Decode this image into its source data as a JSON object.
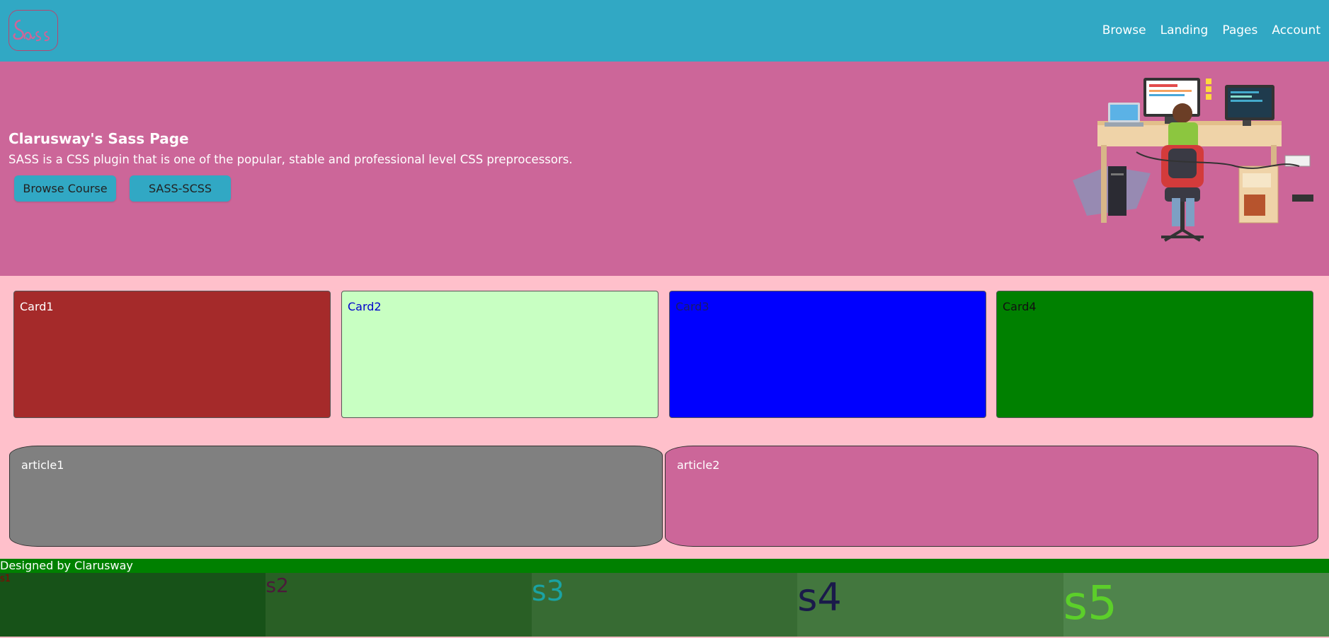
{
  "navbar": {
    "logo_text": "Sass",
    "links": [
      "Browse",
      "Landing",
      "Pages",
      "Account"
    ]
  },
  "hero": {
    "title": "Clarusway's Sass Page",
    "text": "SASS is a CSS plugin that is one of the popular, stable and professional level CSS preprocessors.",
    "buttons": [
      "Browse Course",
      "SASS-SCSS"
    ]
  },
  "cards": [
    "Card1",
    "Card2",
    "Card3",
    "Card4"
  ],
  "articles": [
    "article1",
    "article2"
  ],
  "footer": {
    "text": "Designed by Clarusway"
  },
  "sections": [
    "s1",
    "s2",
    "s3",
    "s4",
    "s5"
  ],
  "colors": {
    "navbar": "#31a8c4",
    "hero": "#cc6699",
    "page_bg": "#ffc0cb",
    "footer": "#008000"
  }
}
